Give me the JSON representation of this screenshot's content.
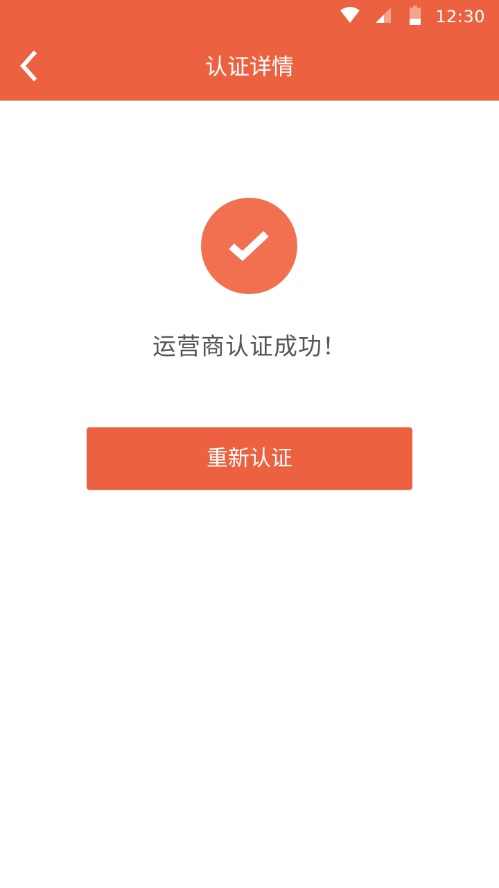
{
  "status_bar": {
    "time": "12:30",
    "icons": [
      "wifi-icon",
      "cell-signal-icon",
      "battery-icon"
    ]
  },
  "app_bar": {
    "back_icon": "chevron-left-icon",
    "title": "认证详情"
  },
  "main": {
    "status_icon": "check-circle-icon",
    "message": "运营商认证成功！",
    "reauth_button_label": "重新认证"
  },
  "colors": {
    "primary": "#ec6241",
    "check_circle": "#f07050",
    "text_secondary": "#555555",
    "background": "#ffffff"
  }
}
